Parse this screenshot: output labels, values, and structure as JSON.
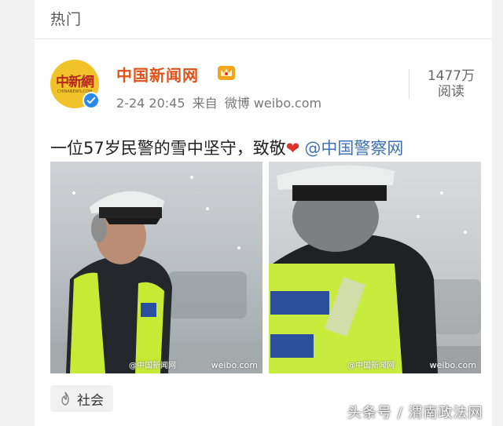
{
  "section": {
    "title": "热门"
  },
  "post": {
    "author": "中国新闻网",
    "avatar_text": "中新網",
    "avatar_subtext": "CHINANEWS.COM",
    "date": "2-24 20:45",
    "source_prefix": "来自",
    "source": "微博 weibo.com",
    "reads_count": "1477万",
    "reads_label": "阅读",
    "text": "一位57岁民警的雪中坚守，致敬",
    "emoji": "❤",
    "mention": "@中国警察网",
    "images": [
      {
        "watermark_site": "weibo.com",
        "watermark_src": "@中国新闻网"
      },
      {
        "watermark_site": "weibo.com",
        "watermark_src": "@中国新闻网"
      }
    ],
    "tag": "社会"
  },
  "footer": {
    "watermark": "头条号 / 渭南政法网"
  },
  "colors": {
    "author": "#e0521b",
    "mention": "#3d73b7",
    "verified": "#2b8ae8",
    "avatar": "#f1c32b"
  },
  "icons": [
    "crown-icon",
    "verified-icon",
    "heart-icon",
    "flame-icon"
  ]
}
